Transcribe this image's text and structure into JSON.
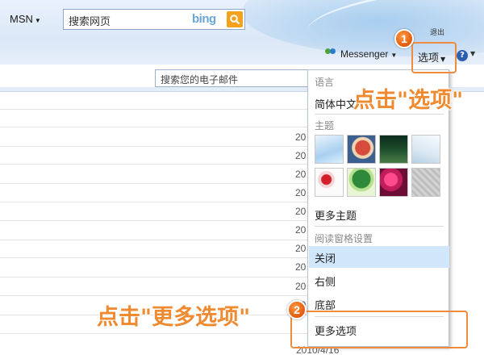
{
  "header": {
    "brand": "MSN",
    "search_placeholder": "搜索网页",
    "bing_logo": "bing",
    "logout": "退出",
    "messenger": "Messenger",
    "options": "选项",
    "help": "?"
  },
  "mail": {
    "search_placeholder": "搜索您的电子邮件",
    "dates": [
      "20",
      "20",
      "20",
      "20",
      "20",
      "20",
      "20",
      "20",
      "20",
      "20"
    ],
    "last_date": "2010/4/16"
  },
  "menu": {
    "section_language": "语言",
    "language_value": "简体中文",
    "section_theme": "主题",
    "themes": [
      "sky-theme",
      "girl-theme",
      "dark-grass-theme",
      "paper-theme",
      "flower-theme",
      "tree-theme",
      "pink-flower-theme",
      "gray-texture-theme"
    ],
    "more_themes": "更多主题",
    "section_reading_pane": "阅读窗格设置",
    "reading_pane_options": [
      "关闭",
      "右侧",
      "底部"
    ],
    "selected_reading_pane": "关闭",
    "more_options": "更多选项"
  },
  "annotations": {
    "step1_number": "1",
    "step1_text": "点击\"选项\"",
    "step2_number": "2",
    "step2_text": "点击\"更多选项\"",
    "highlight_color": "#ee8b3d"
  }
}
